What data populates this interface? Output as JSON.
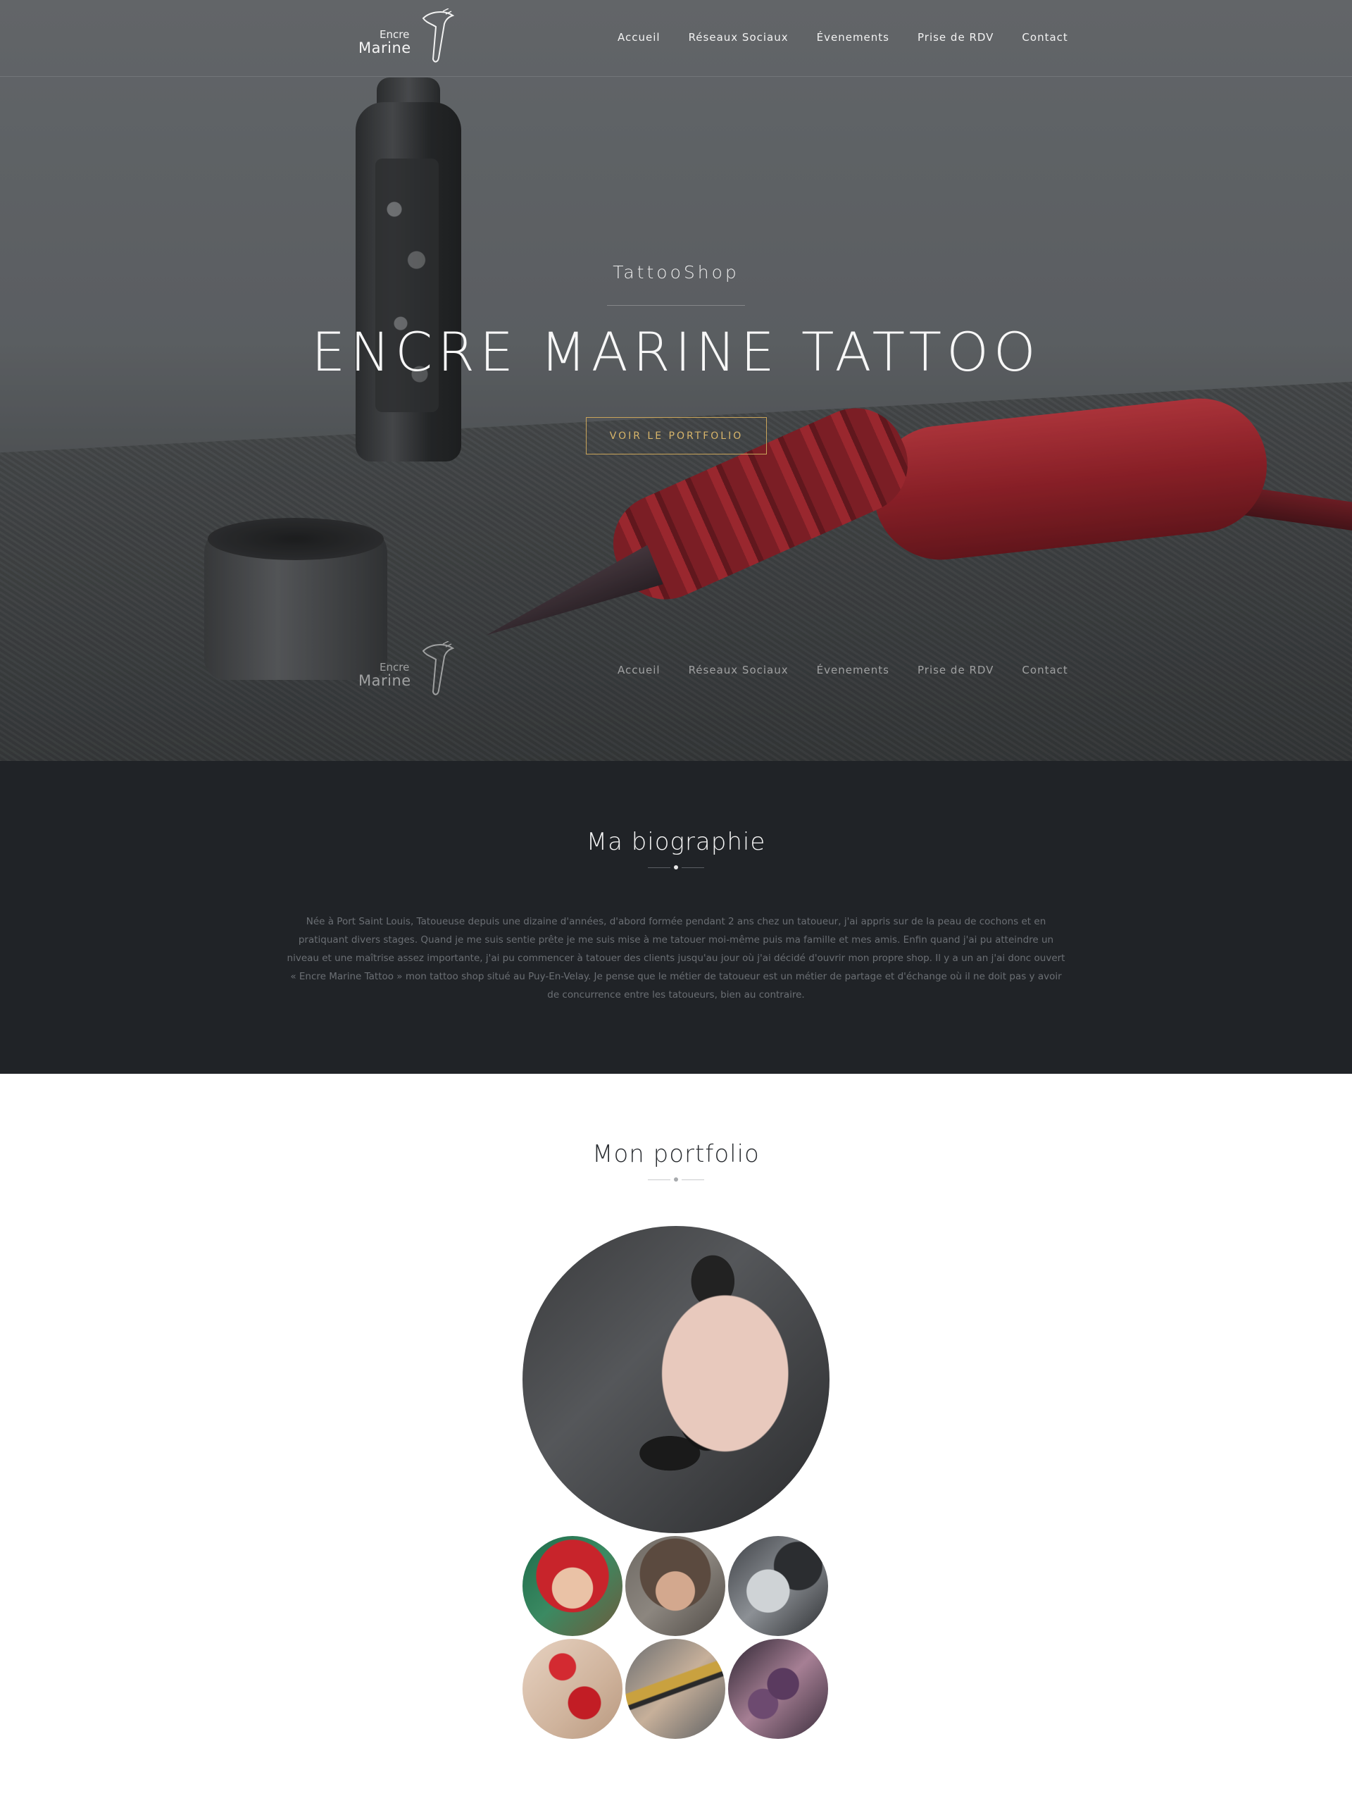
{
  "brand": {
    "logo_line1": "Encre",
    "logo_line2": "Marine"
  },
  "nav": {
    "items": [
      {
        "label": "Accueil"
      },
      {
        "label": "Réseaux Sociaux"
      },
      {
        "label": "Évenements"
      },
      {
        "label": "Prise de RDV"
      },
      {
        "label": "Contact"
      }
    ]
  },
  "hero": {
    "subtitle": "TattooShop",
    "title": "ENCRE MARINE TATTOO",
    "cta_label": "VOIR LE PORTFOLIO"
  },
  "bio": {
    "title": "Ma biographie",
    "text": "Née à Port Saint Louis, Tatoueuse depuis une dizaine d'années, d'abord formée pendant 2 ans chez un tatoueur, j'ai appris sur de la peau de cochons et en pratiquant divers stages. Quand je me suis sentie prête je me suis mise à me tatouer moi-même puis ma famille et mes amis. Enfin quand j'ai pu atteindre un niveau et une maîtrise assez importante, j'ai pu commencer à tatouer des clients jusqu'au jour où j'ai décidé d'ouvrir mon propre shop. Il y a un an j'ai donc ouvert « Encre Marine Tattoo » mon tattoo shop situé au Puy-En-Velay. Je pense que le métier de tatoueur est un métier de partage et d'échange où il ne doit pas y avoir de concurrence entre les tatoueurs, bien au contraire."
  },
  "portfolio": {
    "title": "Mon portfolio"
  },
  "colors": {
    "accent_gold": "#c9a45a",
    "bio_background": "#202327",
    "hero_overlay": "#6f7276"
  },
  "icons": {
    "logo_mark": "tattoo-machine-icon"
  }
}
